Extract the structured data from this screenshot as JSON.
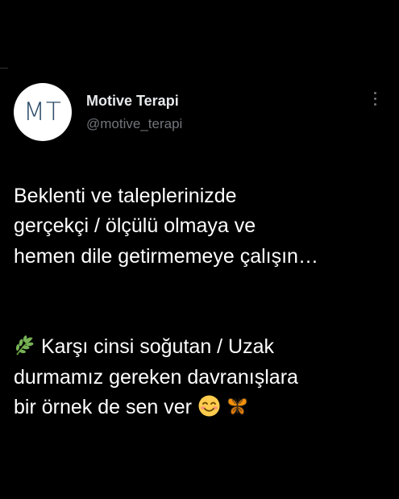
{
  "tweet": {
    "avatar_text": "MT",
    "display_name": "Motive Terapi",
    "handle": "@motive_terapi",
    "paragraph1": "Beklenti ve taleplerinizde\ngerçekçi / ölçülü olmaya ve\nhemen dile getirmemeye çalışın…",
    "paragraph2_text": "Karşı cinsi soğutan / Uzak\ndurmamız gereken davranışlara\nbir örnek de sen ver",
    "icons": {
      "leaf": "herb-emoji-icon",
      "smile": "smiling-face-emoji-icon",
      "butterfly": "butterfly-emoji-icon",
      "more": "more-options-icon"
    },
    "colors": {
      "background": "#000000",
      "text": "#ffffff",
      "secondary_text": "#71767b",
      "avatar_bg": "#ffffff",
      "avatar_text": "#2d4e6a"
    }
  }
}
